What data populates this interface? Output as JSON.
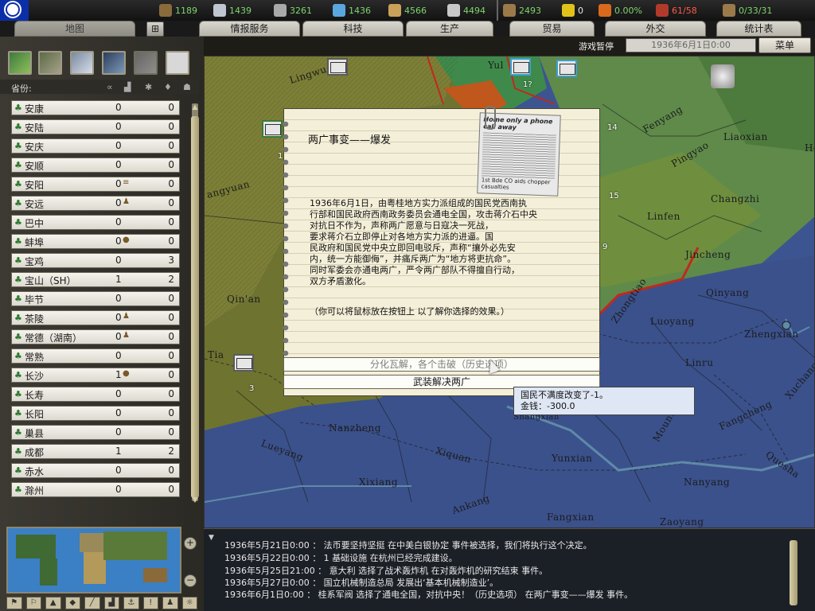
{
  "resources": [
    {
      "name": "energy-icon",
      "value": "1189",
      "color": "#7ed66c",
      "icon_color": "#8a6b3c"
    },
    {
      "name": "metal-icon",
      "value": "1439",
      "color": "#7ed66c",
      "icon_color": "#bfc6d0"
    },
    {
      "name": "rare-materials-icon",
      "value": "3261",
      "color": "#7ed66c",
      "icon_color": "#a9a9a9"
    },
    {
      "name": "oil-icon",
      "value": "1436",
      "color": "#7ed66c",
      "icon_color": "#5aa7e0"
    },
    {
      "name": "supplies-icon",
      "value": "4566",
      "color": "#7ed66c",
      "icon_color": "#c9a25a"
    },
    {
      "name": "money-icon",
      "value": "4494",
      "color": "#7ed66c",
      "icon_color": "#c8c8c8"
    },
    {
      "name": "manpower-icon",
      "value": "2493",
      "color": "#7ed66c",
      "icon_color": "#9b7a4a"
    },
    {
      "name": "nuclear-icon",
      "value": "0",
      "color": "#e8e8e8",
      "icon_color": "#e2c21a"
    },
    {
      "name": "dissent-icon",
      "value": "0.00%",
      "color": "#7ed66c",
      "icon_color": "#d96a1d"
    },
    {
      "name": "transport-icon",
      "value": "61/58",
      "color": "#ff5a4a",
      "icon_color": "#b23a2a"
    },
    {
      "name": "convoy-icon",
      "value": "0/33/31",
      "color": "#7ed66c",
      "icon_color": "#9b7a4a"
    }
  ],
  "tabs": [
    {
      "label": "地图",
      "active": true
    },
    {
      "label": "情报服务",
      "active": false
    },
    {
      "label": "科技",
      "active": false
    },
    {
      "label": "生产",
      "active": false
    },
    {
      "label": "贸易",
      "active": false
    },
    {
      "label": "外交",
      "active": false
    },
    {
      "label": "统计表",
      "active": false
    }
  ],
  "status": {
    "pause_label": "游戏暂停",
    "date": "1936年6月1日0:00",
    "menu_label": "菜单"
  },
  "province_panel": {
    "header": "省份:",
    "header_icons": [
      "infra-icon",
      "industry-icon",
      "aa-icon",
      "oil-icon",
      "manpower-icon"
    ],
    "rows": [
      {
        "name": "安康",
        "v1": "0",
        "v2": "0",
        "badge": ""
      },
      {
        "name": "安陆",
        "v1": "0",
        "v2": "0",
        "badge": ""
      },
      {
        "name": "安庆",
        "v1": "0",
        "v2": "0",
        "badge": ""
      },
      {
        "name": "安顺",
        "v1": "0",
        "v2": "0",
        "badge": ""
      },
      {
        "name": "安阳",
        "v1": "0",
        "v2": "0",
        "badge": "≡"
      },
      {
        "name": "安远",
        "v1": "0",
        "v2": "0",
        "badge": "♟"
      },
      {
        "name": "巴中",
        "v1": "0",
        "v2": "0",
        "badge": ""
      },
      {
        "name": "蚌埠",
        "v1": "0",
        "v2": "0",
        "badge": "●"
      },
      {
        "name": "宝鸡",
        "v1": "0",
        "v2": "3",
        "badge": ""
      },
      {
        "name": "宝山（SH）",
        "v1": "1",
        "v2": "2",
        "badge": ""
      },
      {
        "name": "毕节",
        "v1": "0",
        "v2": "0",
        "badge": ""
      },
      {
        "name": "茶陵",
        "v1": "0",
        "v2": "0",
        "badge": "♟"
      },
      {
        "name": "常德（湖南）",
        "v1": "0",
        "v2": "0",
        "badge": "♟"
      },
      {
        "name": "常熟",
        "v1": "0",
        "v2": "0",
        "badge": ""
      },
      {
        "name": "长沙",
        "v1": "1",
        "v2": "0",
        "badge": "●"
      },
      {
        "name": "长寿",
        "v1": "0",
        "v2": "0",
        "badge": ""
      },
      {
        "name": "长阳",
        "v1": "0",
        "v2": "0",
        "badge": ""
      },
      {
        "name": "巢县",
        "v1": "0",
        "v2": "0",
        "badge": ""
      },
      {
        "name": "成都",
        "v1": "1",
        "v2": "2",
        "badge": ""
      },
      {
        "name": "赤水",
        "v1": "0",
        "v2": "0",
        "badge": ""
      },
      {
        "name": "滁州",
        "v1": "0",
        "v2": "0",
        "badge": ""
      }
    ]
  },
  "map_labels": [
    "Lingwu",
    "Yul",
    "Fenyang",
    "Liaoxian",
    "He",
    "Pingyao",
    "Changzhi",
    "Linfen",
    "Jincheng",
    "angyuan",
    "Qin'an",
    "Tia",
    "Zhongtiao",
    "Qinyang",
    "Luoyang",
    "Zhengxian",
    "Linru",
    "Xuchang",
    "Nanzheng",
    "Lueyang",
    "Xiquan",
    "Fangcheng",
    "Yunxian",
    "Mount",
    "Quesha",
    "Xixiang",
    "Ankang",
    "Nanyang",
    "Fangxian",
    "Zaoyang",
    "Shangxian"
  ],
  "map_counters": [
    "1?",
    "14",
    "15",
    "9",
    "1",
    "3"
  ],
  "event": {
    "title": "两广事变——爆发",
    "body": "1936年6月1日，由粤桂地方实力派组成的国民党西南执\n行部和国民政府西南政务委员会通电全国，攻击蒋介石中央\n对抗日不作为，声称两广愿意与日寇决一死战，\n要求蒋介石立即停止对各地方实力派的进逼。国\n民政府和国民党中央立即回电驳斥，声称“攘外必先安\n内，统一方能御侮”，并痛斥两广为“地方将吏抗命”。\n同时军委会亦通电两广，严令两广部队不得擅自行动，\n双方矛盾激化。",
    "hint": "（你可以将鼠标放在按钮上 以了解你选择的效果。）",
    "newspaper_headline": "Home only a phone call away",
    "newspaper_sub": "1st Bde CO aids chopper casualties",
    "choices": [
      "分化瓦解，各个击破（历史选项）",
      "武装解决两广"
    ]
  },
  "tooltip": {
    "line1": "国民不满度改变了-1。",
    "line2": "金钱：-300.0"
  },
  "log": [
    "1936年5月21日0:00 ： 法币要坚持坚挺 在中美白银协定 事件被选择，我们将执行这个决定。",
    "1936年5月22日0:00 ： 1 基础设施 在杭州已经完成建设。",
    "1936年5月25日21:00 ： 意大利 选择了战术轰炸机 在对轰炸机的研究结束 事件。",
    "1936年5月27日0:00 ： 国立机械制造总局 发展出‘基本机械制造业’。",
    "1936年6月1日0:00 ： 桂系军阀 选择了通电全国，对抗中央！（历史选项） 在两广事变——爆发 事件。"
  ]
}
